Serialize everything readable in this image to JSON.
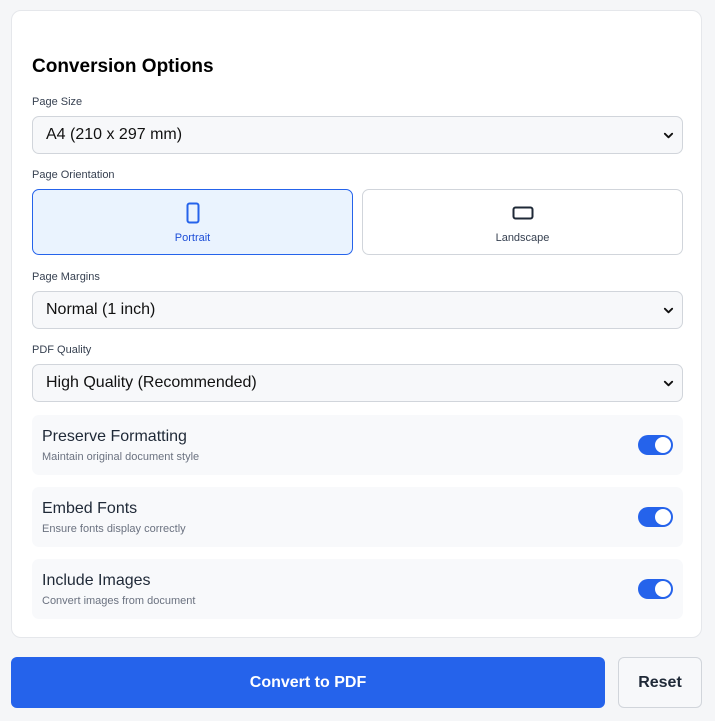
{
  "title": "Conversion Options",
  "page_size": {
    "label": "Page Size",
    "selected": "A4 (210 x 297 mm)"
  },
  "orientation": {
    "label": "Page Orientation",
    "options": [
      {
        "label": "Portrait",
        "icon": "portrait-icon",
        "active": true
      },
      {
        "label": "Landscape",
        "icon": "landscape-icon",
        "active": false
      }
    ]
  },
  "margins": {
    "label": "Page Margins",
    "selected": "Normal (1 inch)"
  },
  "quality": {
    "label": "PDF Quality",
    "selected": "High Quality (Recommended)"
  },
  "toggles": [
    {
      "name": "Preserve Formatting",
      "desc": "Maintain original document style",
      "on": true
    },
    {
      "name": "Embed Fonts",
      "desc": "Ensure fonts display correctly",
      "on": true
    },
    {
      "name": "Include Images",
      "desc": "Convert images from document",
      "on": true
    }
  ],
  "actions": {
    "convert": "Convert to PDF",
    "reset": "Reset"
  },
  "colors": {
    "accent": "#2563eb",
    "active_bg": "#eaf3fe"
  }
}
